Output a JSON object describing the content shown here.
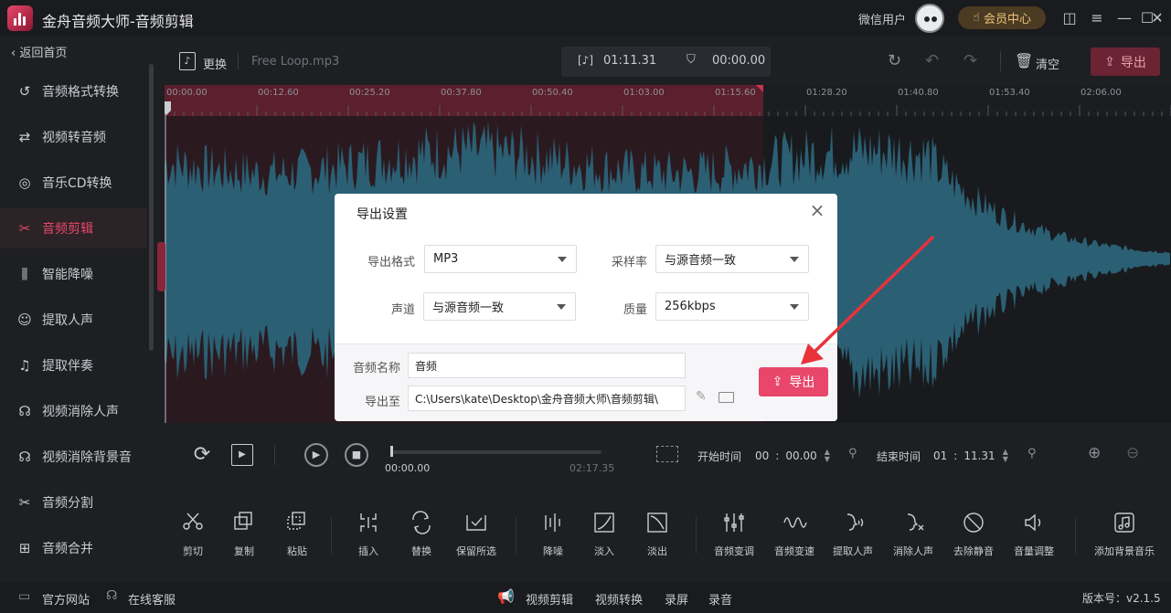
{
  "app": {
    "title": "金舟音频大师-音频剪辑",
    "user_name": "微信用户",
    "vip_label": "会员中心",
    "accent": "#e8476b",
    "vip_color": "#e9c27a"
  },
  "sidebar": {
    "back_label": "返回首页",
    "items": [
      {
        "label": "音频格式转换",
        "icon": "format-convert-icon"
      },
      {
        "label": "视频转音频",
        "icon": "video-to-audio-icon"
      },
      {
        "label": "音乐CD转换",
        "icon": "cd-icon"
      },
      {
        "label": "音频剪辑",
        "icon": "audio-cut-icon",
        "active": true
      },
      {
        "label": "智能降噪",
        "icon": "denoise-icon"
      },
      {
        "label": "提取人声",
        "icon": "extract-voice-icon"
      },
      {
        "label": "提取伴奏",
        "icon": "extract-accompaniment-icon"
      },
      {
        "label": "视频消除人声",
        "icon": "video-remove-voice-icon"
      },
      {
        "label": "视频消除背景音",
        "icon": "video-remove-bg-icon"
      },
      {
        "label": "音频分割",
        "icon": "audio-split-icon"
      },
      {
        "label": "音频合并",
        "icon": "audio-merge-icon"
      }
    ]
  },
  "toolbar": {
    "replace_label": "更换",
    "file_name": "Free Loop.mp3",
    "duration": "01:11.31",
    "position": "00:00.00",
    "clear_label": "清空",
    "export_label": "导出"
  },
  "timeline": {
    "ticks": [
      "00:00.00",
      "00:12.60",
      "00:25.20",
      "00:37.80",
      "00:50.40",
      "01:03.00",
      "01:15.60",
      "01:28.20",
      "01:40.80",
      "01:53.40",
      "02:06.00"
    ],
    "selection_fraction": 0.595
  },
  "transport": {
    "current_time": "00:00.00",
    "total_time": "02:17.35",
    "start_label": "开始时间",
    "start_min": "00",
    "start_sec": "00.00",
    "end_label": "结束时间",
    "end_min": "01",
    "end_sec": "11.31"
  },
  "tools": [
    {
      "label": "剪切"
    },
    {
      "label": "复制"
    },
    {
      "label": "粘贴"
    },
    {
      "label": "插入"
    },
    {
      "label": "替换"
    },
    {
      "label": "保留所选"
    },
    {
      "label": "降噪"
    },
    {
      "label": "淡入"
    },
    {
      "label": "淡出"
    },
    {
      "label": "音频变调"
    },
    {
      "label": "音频变速"
    },
    {
      "label": "提取人声"
    },
    {
      "label": "消除人声"
    },
    {
      "label": "去除静音"
    },
    {
      "label": "音量调整"
    },
    {
      "label": "添加背景音乐"
    }
  ],
  "statusbar": {
    "website": "官方网站",
    "support": "在线客服",
    "video_edit": "视频剪辑",
    "video_convert": "视频转换",
    "screen_record": "录屏",
    "audio_record": "录音",
    "version": "版本号：v2.1.5"
  },
  "dialog": {
    "title": "导出设置",
    "format_label": "导出格式",
    "format_value": "MP3",
    "samplerate_label": "采样率",
    "samplerate_value": "与源音频一致",
    "channel_label": "声道",
    "channel_value": "与源音频一致",
    "quality_label": "质量",
    "quality_value": "256kbps",
    "name_label": "音频名称",
    "name_value": "音频",
    "path_label": "导出至",
    "path_value": "C:\\Users\\kate\\Desktop\\金舟音频大师\\音频剪辑\\",
    "export_label": "导出"
  }
}
